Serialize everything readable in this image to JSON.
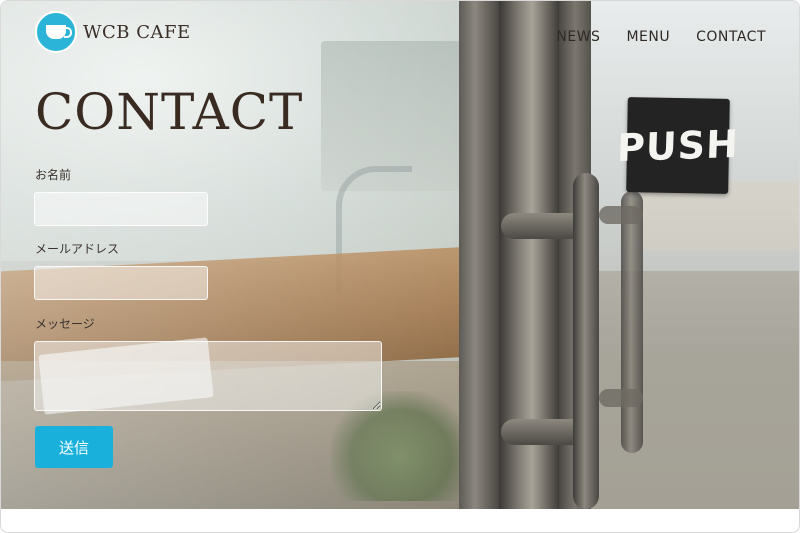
{
  "header": {
    "logo_text": "WCB CAFE",
    "nav": [
      {
        "label": "NEWS"
      },
      {
        "label": "MENU"
      },
      {
        "label": "CONTACT"
      }
    ]
  },
  "page_title": "CONTACT",
  "form": {
    "name_label": "お名前",
    "name_value": "",
    "email_label": "メールアドレス",
    "email_value": "",
    "message_label": "メッセージ",
    "message_value": "",
    "submit_label": "送信"
  },
  "background": {
    "door_sign_text": "PUSH"
  },
  "colors": {
    "accent": "#19b1dc",
    "title_text": "#3a2b22"
  }
}
